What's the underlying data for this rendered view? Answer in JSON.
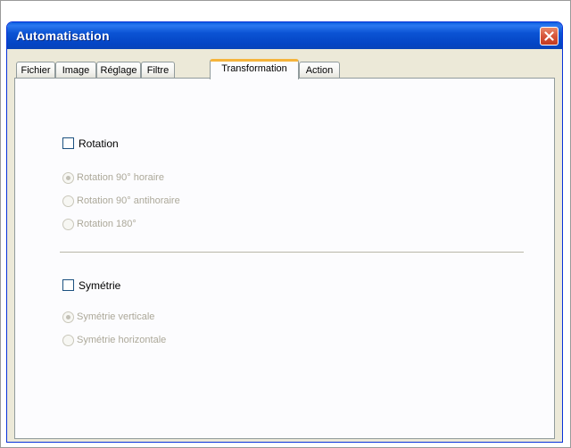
{
  "window": {
    "title": "Automatisation"
  },
  "tabs": [
    {
      "label": "Fichier"
    },
    {
      "label": "Image"
    },
    {
      "label": "Réglage"
    },
    {
      "label": "Filtre"
    },
    {
      "label": "Transformation",
      "active": true
    },
    {
      "label": "Action"
    }
  ],
  "rotation": {
    "label": "Rotation",
    "checked": false,
    "options": [
      {
        "label": "Rotation 90° horaire",
        "selected": true,
        "enabled": false
      },
      {
        "label": "Rotation 90° antihoraire",
        "selected": false,
        "enabled": false
      },
      {
        "label": "Rotation 180°",
        "selected": false,
        "enabled": false
      }
    ]
  },
  "symmetry": {
    "label": "Symétrie",
    "checked": false,
    "options": [
      {
        "label": "Symétrie verticale",
        "selected": true,
        "enabled": false
      },
      {
        "label": "Symétrie horizontale",
        "selected": false,
        "enabled": false
      }
    ]
  },
  "colors": {
    "titlebar": "#0b53d4",
    "close_button": "#d6553a",
    "active_tab_accent": "#f5b43c",
    "dialog_background": "#ece9d8",
    "disabled_text": "#aca899"
  },
  "icons": {
    "close": "close-icon"
  }
}
